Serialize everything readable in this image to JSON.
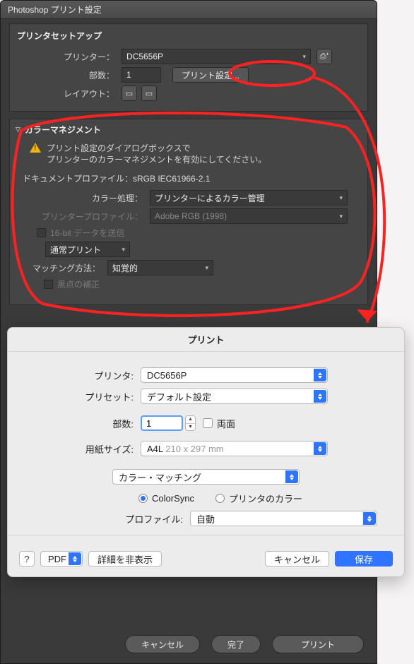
{
  "ps": {
    "title": "Photoshop プリント設定",
    "setup_heading": "プリンタセットアップ",
    "printer_label": "プリンター：",
    "printer_value": "DC5656P",
    "printer_icon_name": "printer-plus-icon",
    "copies_label": "部数：",
    "copies_value": "1",
    "print_settings_btn": "プリント設定...",
    "layout_label": "レイアウト：",
    "cm_heading": "カラーマネジメント",
    "warning_line1": "プリント設定のダイアログボックスで",
    "warning_line2": "プリンターのカラーマネジメントを有効にしてください。",
    "doc_profile_line": "ドキュメントプロファイル：sRGB IEC61966-2.1",
    "color_handling_label": "カラー処理：",
    "color_handling_value": "プリンターによるカラー管理",
    "printer_profile_label": "プリンタープロファイル：",
    "printer_profile_value": "Adobe RGB (1998)",
    "send16_label": "16-bit データを送信",
    "print_type_value": "通常プリント",
    "render_intent_label": "マッチング方法：",
    "render_intent_value": "知覚的",
    "bpc_label": "黒点の補正",
    "footer_cancel": "キャンセル",
    "footer_done": "完了",
    "footer_print": "プリント"
  },
  "mac": {
    "title": "プリント",
    "printer_label": "プリンタ:",
    "printer_value": "DC5656P",
    "preset_label": "プリセット:",
    "preset_value": "デフォルト設定",
    "copies_label": "部数:",
    "copies_value": "1",
    "duplex_label": "両面",
    "paper_label": "用紙サイズ:",
    "paper_primary": "A4L ",
    "paper_secondary": "210 x 297 mm",
    "section_value": "カラー・マッチング",
    "radio_colorsync": "ColorSync",
    "radio_printer_color": "プリンタのカラー",
    "profile_label": "プロファイル:",
    "profile_value": "自動",
    "help": "?",
    "pdf": "PDF",
    "hide_details": "詳細を非表示",
    "cancel": "キャンセル",
    "save": "保存"
  }
}
